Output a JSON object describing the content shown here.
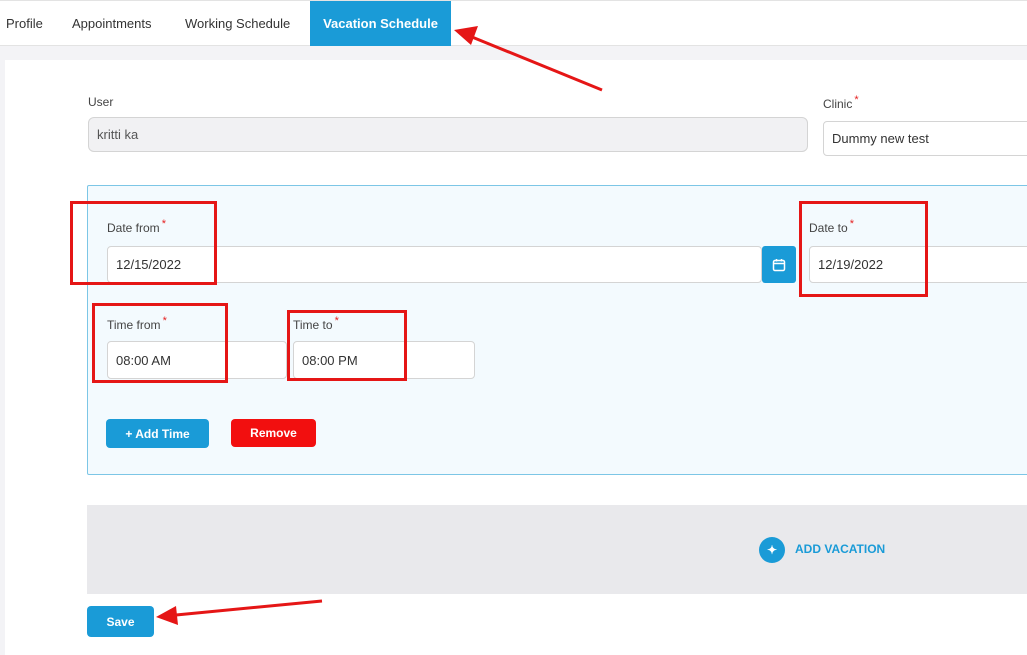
{
  "tabs": [
    {
      "label": "Profile"
    },
    {
      "label": "Appointments"
    },
    {
      "label": "Working Schedule"
    },
    {
      "label": "Vacation Schedule",
      "active": true
    }
  ],
  "form": {
    "user_label": "User",
    "user_value": "kritti ka",
    "clinic_label": "Clinic",
    "clinic_value": "Dummy new test",
    "required_mark": "*"
  },
  "vacation_entry": {
    "date_from_label": "Date from",
    "date_from_value": "12/15/2022",
    "date_to_label": "Date to",
    "date_to_value": "12/19/2022",
    "time_from_label": "Time from",
    "time_from_value": "08:00 AM",
    "time_to_label": "Time to",
    "time_to_value": "08:00 PM",
    "add_time_label": "+ Add Time",
    "remove_label": "Remove"
  },
  "add_vacation": {
    "icon": "plus-icon",
    "label": "ADD VACATION"
  },
  "save_label": "Save",
  "colors": {
    "primary": "#1a9bd7",
    "danger": "#f20f0f",
    "annotation": "#e51616"
  }
}
